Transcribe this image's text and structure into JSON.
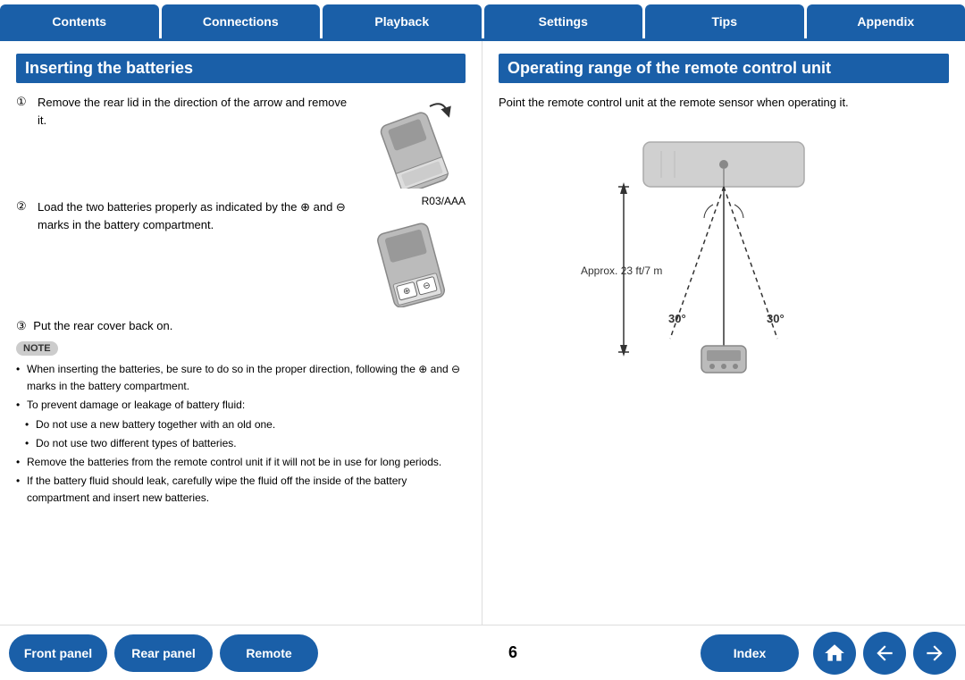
{
  "nav": {
    "tabs": [
      "Contents",
      "Connections",
      "Playback",
      "Settings",
      "Tips",
      "Appendix"
    ]
  },
  "left": {
    "section_title": "Inserting the batteries",
    "steps": [
      {
        "number": "①",
        "text": "Remove the rear lid in the direction of the arrow and remove it."
      },
      {
        "number": "②",
        "text": "Load the two batteries properly as indicated by the ⊕ and ⊖ marks in the battery compartment.",
        "label": "R03/AAA"
      },
      {
        "number": "③",
        "text": "Put the rear cover back on."
      }
    ],
    "note_label": "NOTE",
    "notes": [
      "When inserting the batteries, be sure to do so in the proper direction, following the ⊕ and ⊖ marks in the battery compartment.",
      "To prevent damage or leakage of battery fluid:",
      "Do not use a new battery together with an old one.",
      "Do not use two different types of batteries.",
      "Remove the batteries from the remote control unit if it will not be in use for long periods.",
      "If the battery fluid should leak, carefully wipe the fluid off the inside of the battery compartment and insert new batteries."
    ]
  },
  "right": {
    "section_title": "Operating range of the remote control unit",
    "intro": "Point the remote control unit at the remote sensor when operating it.",
    "approx_label": "Approx. 23 ft/7 m",
    "angle_left": "30°",
    "angle_right": "30°"
  },
  "bottom": {
    "buttons": [
      "Front panel",
      "Rear panel",
      "Remote",
      "Index"
    ],
    "page_number": "6"
  }
}
